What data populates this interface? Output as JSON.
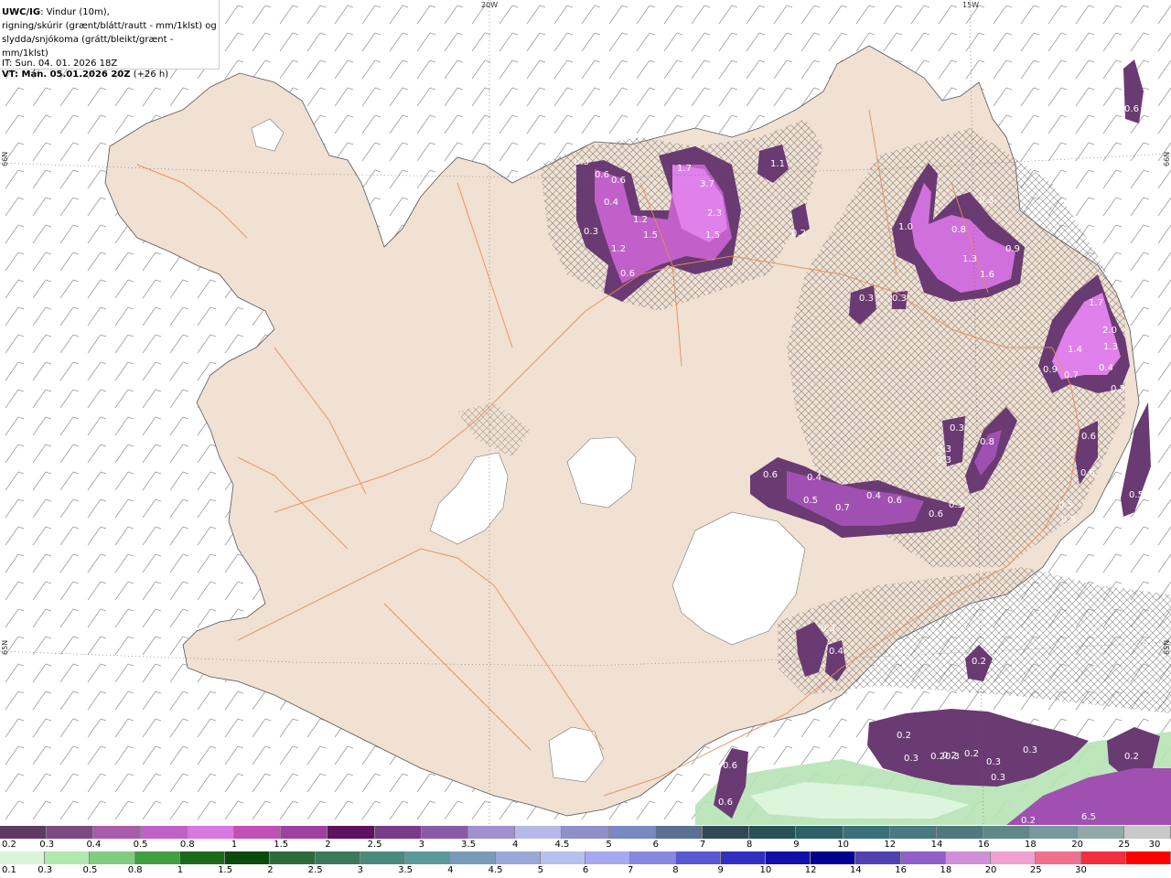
{
  "title": {
    "model": "UWC/IG",
    "line1_rest": ": Vindur (10m),",
    "line2": "rigning/skúrir (grænt/blátt/rautt - mm/1klst) og",
    "line3": "slydda/snjókoma (grátt/bleikt/grænt - mm/1klst)",
    "it": "IT: Sun. 04. 01. 2026 18Z",
    "vt_label": "VT: Mán. 05.01.2026 20Z",
    "vt_offset": " (+26 h)"
  },
  "coords": {
    "lon_20w": "20W",
    "lon_15w": "15W",
    "lat_66n_left": "66N",
    "lat_66n_right": "66N",
    "lat_65n_left": "65N",
    "lat_65n_right": "65N"
  },
  "snow_labels": [
    "0.3",
    "0.6",
    "0.6",
    "0.4",
    "0.3",
    "1.2",
    "1.5",
    "1.2",
    "0.6",
    "1.7",
    "3.7",
    "2.3",
    "1.5",
    "1.1",
    "0.2",
    "1.0",
    "0.3",
    "0.8",
    "1.3",
    "1.6",
    "0.9",
    "0.3",
    "0.3",
    "0.6",
    "1.7",
    "2.0",
    "1.4",
    "1.3",
    "0.9",
    "0.7",
    "0.4",
    "0.5",
    "0.3",
    "0.3",
    "0.3",
    "0.8",
    "0.6",
    "0.6",
    "0.6",
    "0.4",
    "0.5",
    "0.7",
    "0.4",
    "0.6",
    "0.6",
    "0.3",
    "0.5",
    "0.3",
    "0.4",
    "0.2",
    "0.2",
    "0.3",
    "0.20.3",
    "0.2",
    "0.2",
    "0.3",
    "0.3",
    "0.3",
    "0.2",
    "0.6",
    "0.6",
    "0.2",
    "6.5",
    "0.5",
    "0.5"
  ],
  "legend_snow": {
    "colors": [
      "#5e3a63",
      "#7a4a80",
      "#a85ba8",
      "#c060c8",
      "#d878e0",
      "#c050b8",
      "#a040a0",
      "#601060",
      "#7a3a8a",
      "#8a5aa8",
      "#a090d0",
      "#b8b8e8",
      "#9090c8",
      "#7888c0",
      "#5a7090",
      "#304858",
      "#2a5058",
      "#2e6068",
      "#3a7078",
      "#487880",
      "#507880",
      "#608888",
      "#7898a0",
      "#90a8a8",
      "#c8c8c8"
    ],
    "labels": [
      "0.2",
      "0.3",
      "0.4",
      "0.5",
      "0.8",
      "1",
      "1.5",
      "2",
      "2.5",
      "3",
      "3.5",
      "4",
      "4.5",
      "5",
      "6",
      "7",
      "8",
      "9",
      "10",
      "12",
      "14",
      "16",
      "18",
      "20",
      "25",
      "30"
    ]
  },
  "legend_rain": {
    "colors": [
      "#d8f5d8",
      "#b0e8b0",
      "#80cc80",
      "#40a040",
      "#1a6a1a",
      "#0a4a0a",
      "#2e6a3a",
      "#3a7a5a",
      "#4a8a7a",
      "#5a9a9a",
      "#7a9aba",
      "#9aa8d8",
      "#b8c0f0",
      "#a8a8f0",
      "#8888e0",
      "#5858d0",
      "#3030c0",
      "#1010a8",
      "#000090",
      "#5040b0",
      "#9060c8",
      "#d090d8",
      "#f0a0d0",
      "#f07090",
      "#f03040",
      "#ff0000"
    ],
    "labels": [
      "0.1",
      "0.3",
      "0.5",
      "0.8",
      "1",
      "1.5",
      "2",
      "2.5",
      "3",
      "3.5",
      "4",
      "4.5",
      "5",
      "6",
      "7",
      "8",
      "9",
      "10",
      "12",
      "14",
      "16",
      "18",
      "20",
      "25",
      "30"
    ]
  }
}
